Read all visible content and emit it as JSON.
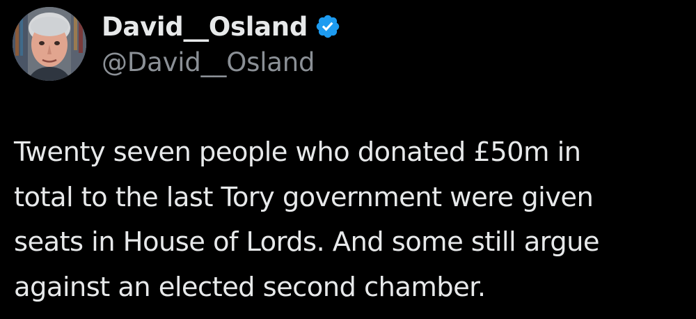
{
  "author": {
    "display_name": "David__Osland",
    "handle": "@David__Osland",
    "verified": true,
    "verified_icon": "verified-badge-icon",
    "verified_color": "#1d9bf0",
    "avatar_icon": "profile-photo"
  },
  "tweet": {
    "lines": [
      "Twenty seven people who donated £50m in",
      "total to the last Tory government were given",
      "seats in House of Lords. And some still argue",
      "against an elected second chamber."
    ]
  },
  "theme": {
    "background": "#000000",
    "text_primary": "#e7e9ea",
    "text_secondary": "#8b9096"
  }
}
